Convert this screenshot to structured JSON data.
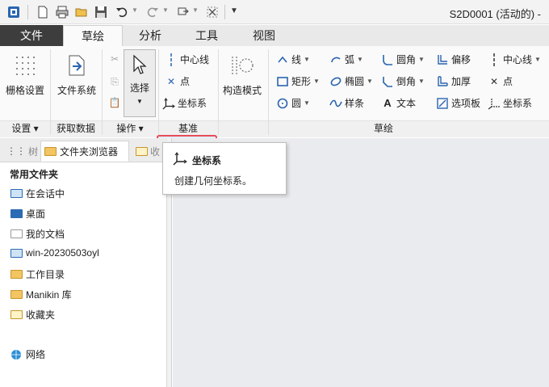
{
  "window": {
    "title": "S2D0001 (活动的) -"
  },
  "quick_access": {
    "icons": [
      "app-icon",
      "new-icon",
      "print-icon",
      "open-icon",
      "save-icon",
      "undo-icon",
      "redo-icon",
      "regenerate-icon",
      "close-window-icon",
      "customize-icon"
    ]
  },
  "tabs": [
    {
      "label": "文件"
    },
    {
      "label": "草绘"
    },
    {
      "label": "分析"
    },
    {
      "label": "工具"
    },
    {
      "label": "视图"
    }
  ],
  "ribbon": {
    "grid_settings": "栅格设置",
    "file_system": "文件系统",
    "select": "选择",
    "datum_centerline": "中心线",
    "datum_point": "点",
    "datum_coordsys": "坐标系",
    "construction_mode": "构造模式",
    "sketch": {
      "line": "线",
      "arc": "弧",
      "fillet": "圆角",
      "offset": "偏移",
      "centerline": "中心线",
      "rectangle": "矩形",
      "ellipse": "椭圆",
      "chamfer": "倒角",
      "thicken": "加厚",
      "point": "点",
      "circle": "圆",
      "spline": "样条",
      "text": "文本",
      "palette": "选项板",
      "coordsys": "坐标系"
    },
    "groups": {
      "setup": "设置",
      "get_data": "获取数据",
      "operations": "操作",
      "datum": "基准",
      "sketching": "草绘"
    }
  },
  "nav_tabs": {
    "tab1": "树",
    "tab2": "文件夹浏览器",
    "tab3": "收"
  },
  "folders": {
    "header": "常用文件夹",
    "items": [
      {
        "label": "在会话中",
        "icon": "session-icon"
      },
      {
        "label": "桌面",
        "icon": "desktop-icon"
      },
      {
        "label": "我的文档",
        "icon": "documents-icon"
      },
      {
        "label": "win-20230503oyl",
        "icon": "computer-icon"
      },
      {
        "label": "工作目录",
        "icon": "working-directory-icon"
      },
      {
        "label": "Manikin 库",
        "icon": "manikin-library-icon"
      },
      {
        "label": "收藏夹",
        "icon": "favorites-icon"
      },
      {
        "label": "网络",
        "icon": "network-icon"
      }
    ]
  },
  "tooltip": {
    "title": "坐标系",
    "description": "创建几何坐标系。"
  },
  "colors": {
    "file_tab_bg": "#3d3d3d",
    "highlight_border": "#e84b5a",
    "canvas_bg": "#eaebee",
    "icon_blue": "#2a64b0"
  }
}
